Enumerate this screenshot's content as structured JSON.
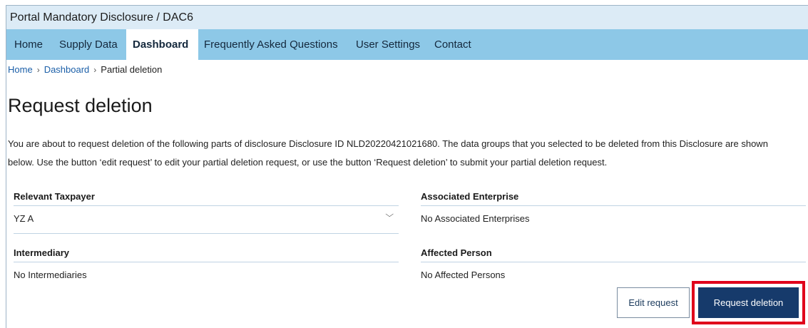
{
  "app": {
    "title": "Portal Mandatory Disclosure / DAC6"
  },
  "nav": {
    "items": [
      {
        "label": "Home"
      },
      {
        "label": "Supply Data"
      },
      {
        "label": "Dashboard",
        "active": true
      },
      {
        "label": "Frequently Asked Questions"
      },
      {
        "label": "User Settings"
      },
      {
        "label": "Contact"
      }
    ]
  },
  "breadcrumb": {
    "items": [
      "Home",
      "Dashboard",
      "Partial deletion"
    ],
    "separator": "›"
  },
  "page": {
    "title": "Request deletion",
    "intro": "You are about to request deletion of the following parts of disclosure Disclosure ID NLD20220421021680. The data groups that you selected to be deleted from this Disclosure are shown below. Use the button ‘edit request’ to edit your partial deletion request, or use the button ‘Request deletion’ to submit your partial deletion request."
  },
  "sections": {
    "relevant_taxpayer": {
      "heading": "Relevant Taxpayer",
      "value": "YZ A"
    },
    "associated_enterprise": {
      "heading": "Associated Enterprise",
      "value": "No Associated Enterprises"
    },
    "intermediary": {
      "heading": "Intermediary",
      "value": "No Intermediaries"
    },
    "affected_person": {
      "heading": "Affected Person",
      "value": "No Affected Persons"
    }
  },
  "actions": {
    "edit_label": "Edit request",
    "delete_label": "Request deletion"
  },
  "colors": {
    "nav_bg": "#8dc8e7",
    "title_bg": "#dcebf6",
    "primary_button": "#163a6b",
    "highlight": "#e0001b"
  },
  "icons": {
    "dropdown": "chevron-down-icon"
  }
}
